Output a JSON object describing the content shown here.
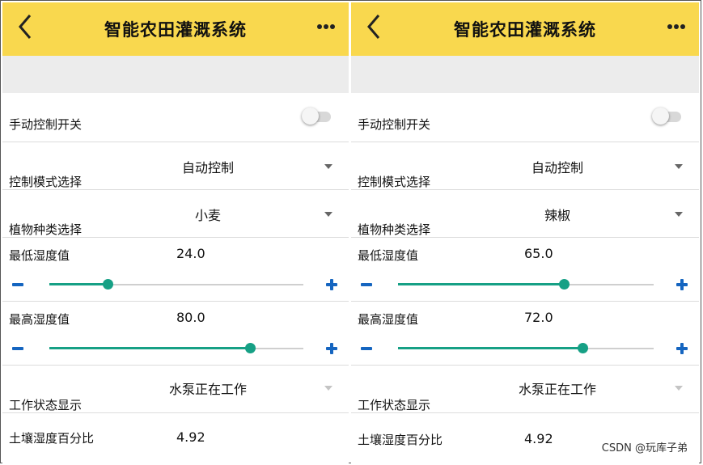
{
  "colors": {
    "appbar": "#f9d84e",
    "accent": "#16a085",
    "stepper": "#1565c0"
  },
  "panels": [
    {
      "title": "智能农田灌溉系统",
      "manual_switch_label": "手动控制开关",
      "manual_switch_on": false,
      "mode_label": "控制模式选择",
      "mode_value": "自动控制",
      "plant_label": "植物种类选择",
      "plant_value": "小麦",
      "min_label": "最低湿度值",
      "min_value": "24.0",
      "min_fraction": 0.23,
      "max_label": "最高湿度值",
      "max_value": "80.0",
      "max_fraction": 0.79,
      "status_label": "工作状态显示",
      "status_value": "水泵正在工作",
      "soil_label": "土壤湿度百分比",
      "soil_value": "4.92"
    },
    {
      "title": "智能农田灌溉系统",
      "manual_switch_label": "手动控制开关",
      "manual_switch_on": false,
      "mode_label": "控制模式选择",
      "mode_value": "自动控制",
      "plant_label": "植物种类选择",
      "plant_value": "辣椒",
      "min_label": "最低湿度值",
      "min_value": "65.0",
      "min_fraction": 0.65,
      "max_label": "最高湿度值",
      "max_value": "72.0",
      "max_fraction": 0.72,
      "status_label": "工作状态显示",
      "status_value": "水泵正在工作",
      "soil_label": "土壤湿度百分比",
      "soil_value": "4.92"
    }
  ],
  "watermark": "CSDN @玩库子弟"
}
